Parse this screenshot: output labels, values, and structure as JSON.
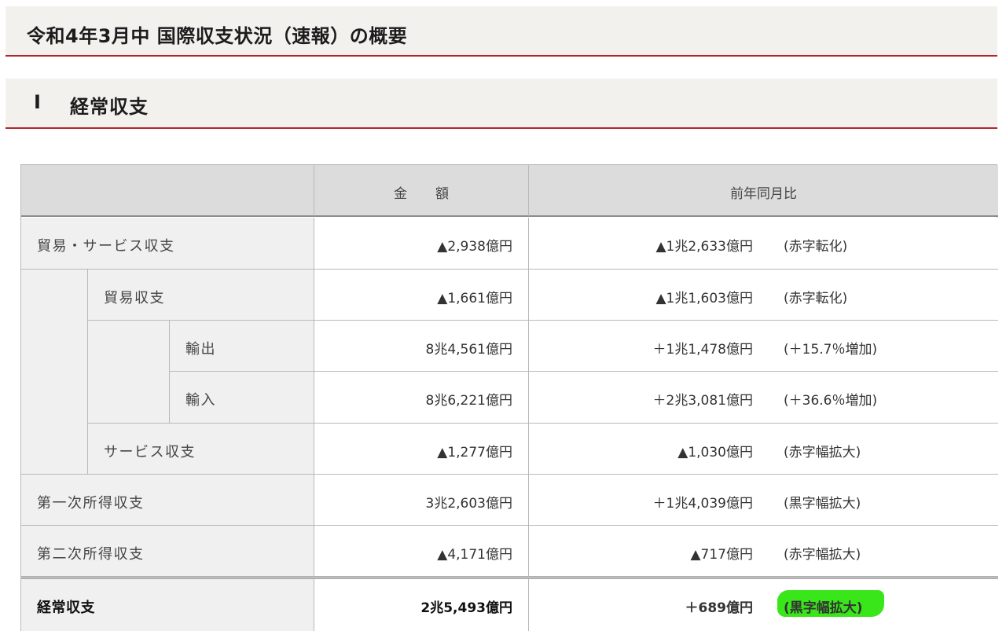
{
  "page": {
    "title": "令和4年3月中 国際収支状況（速報）の概要"
  },
  "section": {
    "number": "Ⅰ",
    "label": "経常収支"
  },
  "table": {
    "headers": [
      "",
      "金 額",
      "前年同月比"
    ],
    "rows": [
      {
        "label": "貿易・サービス収支",
        "amount": "▲2,938億円",
        "change": "▲1兆2,633億円",
        "note": "(赤字転化)"
      },
      {
        "label": "貿易収支",
        "amount": "▲1,661億円",
        "change": "▲1兆1,603億円",
        "note": "(赤字転化)"
      },
      {
        "label": "輸出",
        "amount": "8兆4,561億円",
        "change": "＋1兆1,478億円",
        "note": "(＋15.7％増加)"
      },
      {
        "label": "輸入",
        "amount": "8兆6,221億円",
        "change": "＋2兆3,081億円",
        "note": "(＋36.6％増加)"
      },
      {
        "label": "サービス収支",
        "amount": "▲1,277億円",
        "change": "▲1,030億円",
        "note": "(赤字幅拡大)"
      },
      {
        "label": "第一次所得収支",
        "amount": "3兆2,603億円",
        "change": "＋1兆4,039億円",
        "note": "(黒字幅拡大)"
      },
      {
        "label": "第二次所得収支",
        "amount": "▲4,171億円",
        "change": "▲717億円",
        "note": "(赤字幅拡大)"
      },
      {
        "label": "経常収支",
        "amount": "2兆5,493億円",
        "change": "＋689億円",
        "note": "(黒字幅拡大)"
      }
    ]
  },
  "colors": {
    "accent_rule": "#b0262c",
    "header_bg": "#dcdcdc",
    "label_bg": "#f0f0f0",
    "highlight": "#39e61a"
  }
}
